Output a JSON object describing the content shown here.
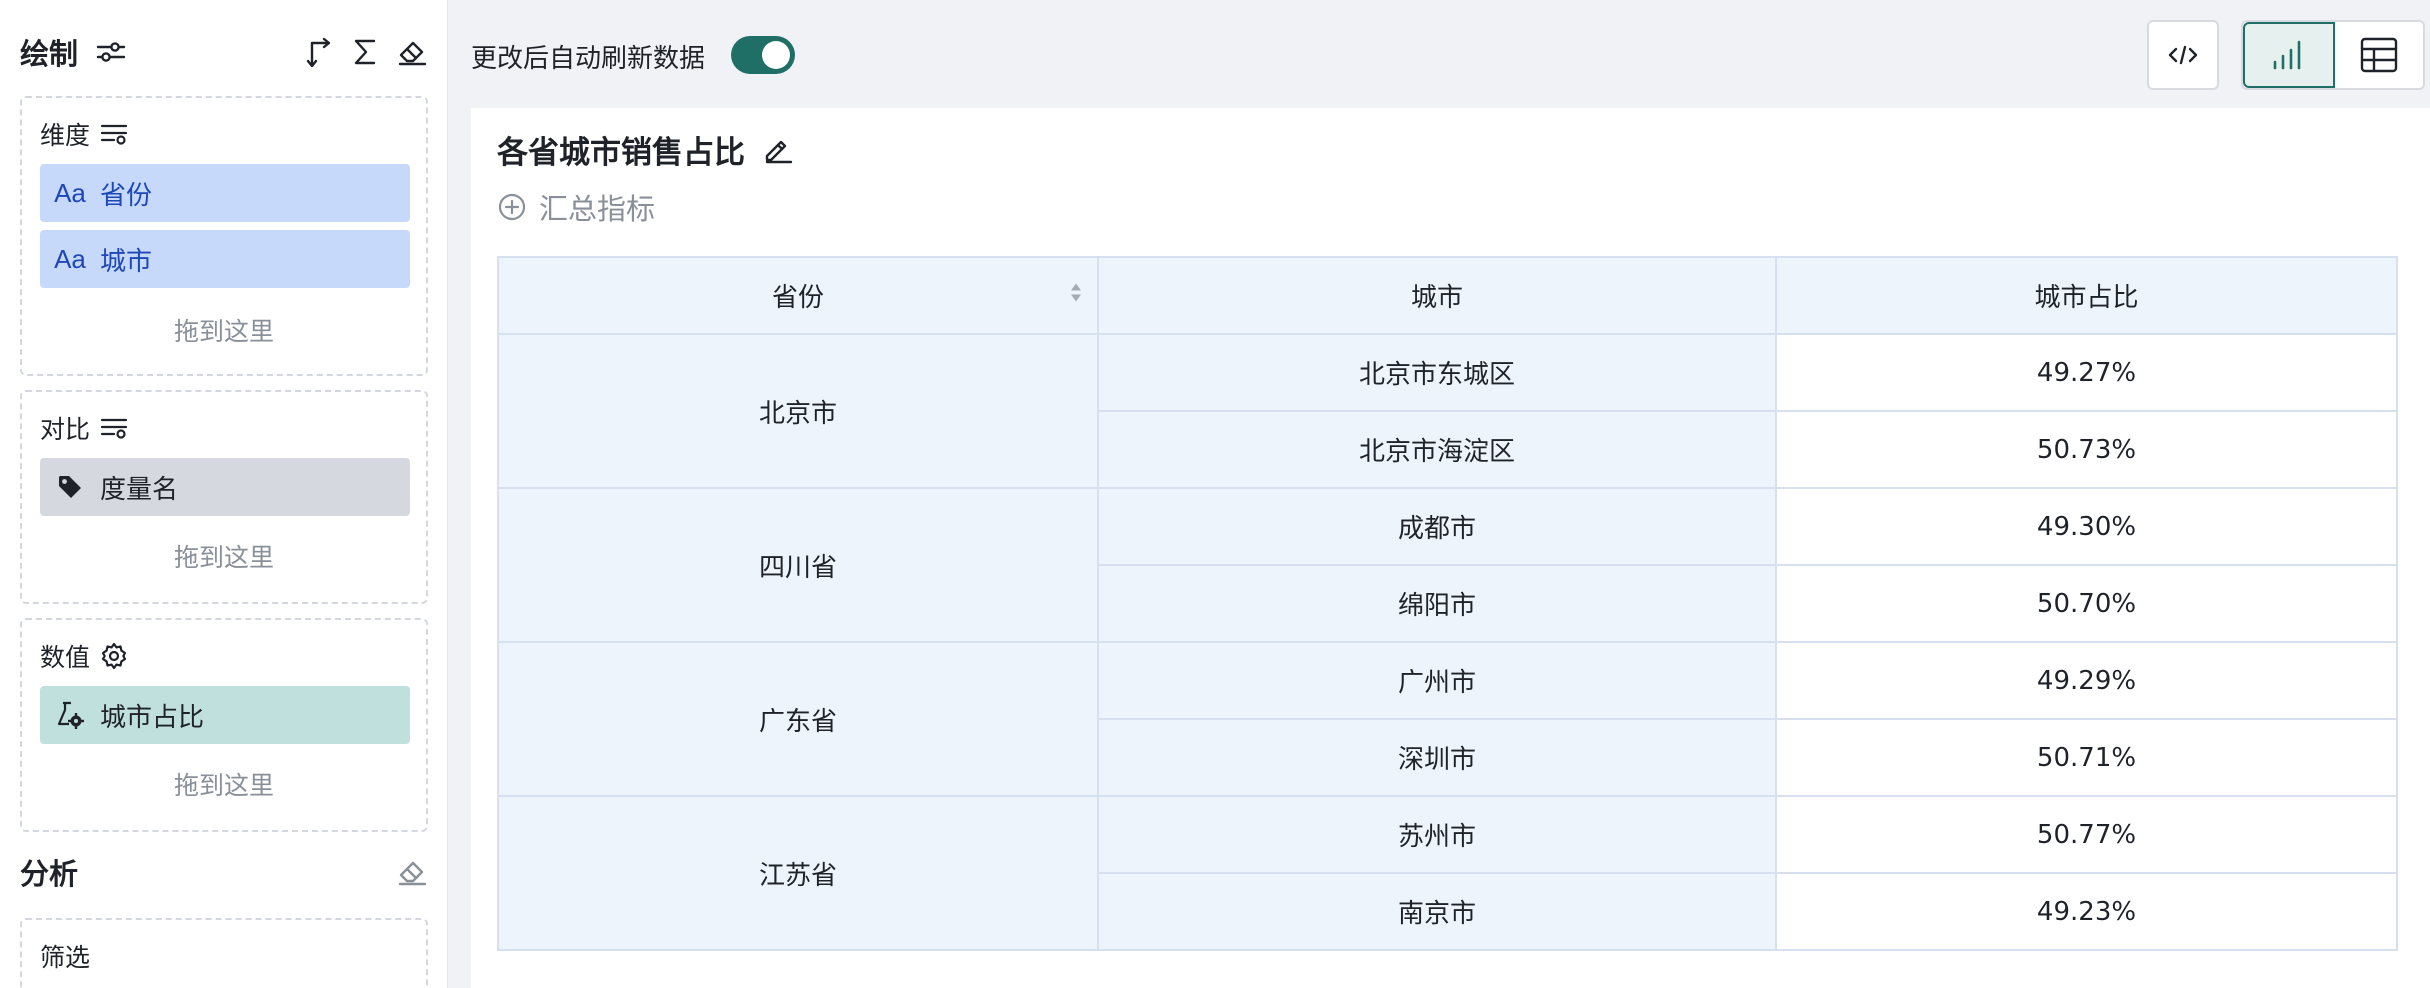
{
  "left_panel": {
    "title": "绘制",
    "dimension": {
      "label": "维度",
      "chips": [
        {
          "icon": "Aa",
          "label": "省份"
        },
        {
          "icon": "Aa",
          "label": "城市"
        }
      ],
      "drop_hint": "拖到这里"
    },
    "compare": {
      "label": "对比",
      "chip": {
        "label": "度量名"
      },
      "drop_hint": "拖到这里"
    },
    "value": {
      "label": "数值",
      "chip": {
        "label": "城市占比"
      },
      "drop_hint": "拖到这里"
    },
    "analysis": {
      "title": "分析",
      "filter_label": "筛选"
    }
  },
  "topbar": {
    "auto_refresh_label": "更改后自动刷新数据",
    "auto_refresh_on": true
  },
  "chart": {
    "title": "各省城市销售占比",
    "add_metric": "汇总指标"
  },
  "table": {
    "headers": [
      "省份",
      "城市",
      "城市占比"
    ],
    "groups": [
      {
        "province": "北京市",
        "rows": [
          {
            "city": "北京市东城区",
            "share": "49.27%"
          },
          {
            "city": "北京市海淀区",
            "share": "50.73%"
          }
        ]
      },
      {
        "province": "四川省",
        "rows": [
          {
            "city": "成都市",
            "share": "49.30%"
          },
          {
            "city": "绵阳市",
            "share": "50.70%"
          }
        ]
      },
      {
        "province": "广东省",
        "rows": [
          {
            "city": "广州市",
            "share": "49.29%"
          },
          {
            "city": "深圳市",
            "share": "50.71%"
          }
        ]
      },
      {
        "province": "江苏省",
        "rows": [
          {
            "city": "苏州市",
            "share": "50.77%"
          },
          {
            "city": "南京市",
            "share": "49.23%"
          }
        ]
      }
    ]
  },
  "colors": {
    "accent": "#1f6f67",
    "dimension_chip": "#c6d9fb",
    "measure_chip": "#d5d9df",
    "value_chip": "#bfe0dc",
    "table_header": "#eef4fc"
  }
}
